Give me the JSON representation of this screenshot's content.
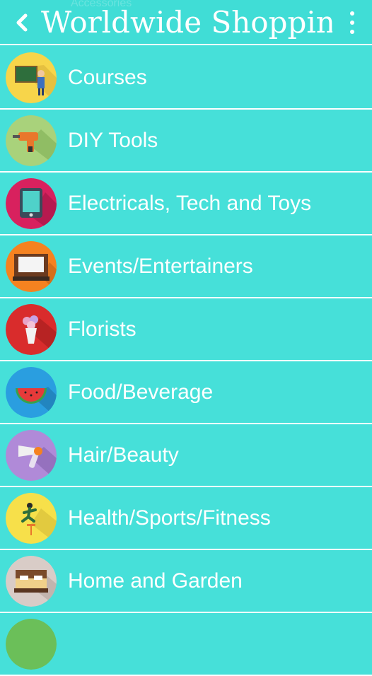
{
  "header": {
    "title": "Worldwide Shoppin",
    "ghost_text": "Accessories",
    "back_icon": "chevron-left-icon",
    "menu_icon": "more-vert-icon"
  },
  "categories": [
    {
      "label": "Courses",
      "icon": "teacher-board-icon",
      "color": "#f7d54a"
    },
    {
      "label": "DIY Tools",
      "icon": "drill-icon",
      "color": "#a9d27b"
    },
    {
      "label": "Electricals, Tech and Toys",
      "icon": "tablet-icon",
      "color": "#d8215e"
    },
    {
      "label": "Events/Entertainers",
      "icon": "stage-icon",
      "color": "#f58220"
    },
    {
      "label": "Florists",
      "icon": "bouquet-icon",
      "color": "#d92c2c"
    },
    {
      "label": "Food/Beverage",
      "icon": "watermelon-icon",
      "color": "#2a9ee0"
    },
    {
      "label": "Hair/Beauty",
      "icon": "hairdryer-icon",
      "color": "#b08ad8"
    },
    {
      "label": "Health/Sports/Fitness",
      "icon": "hurdle-runner-icon",
      "color": "#f7e04a"
    },
    {
      "label": "Home and Garden",
      "icon": "bed-icon",
      "color": "#d9ccc7"
    },
    {
      "label": "",
      "icon": "partial-icon",
      "color": "#6bbf59"
    }
  ]
}
